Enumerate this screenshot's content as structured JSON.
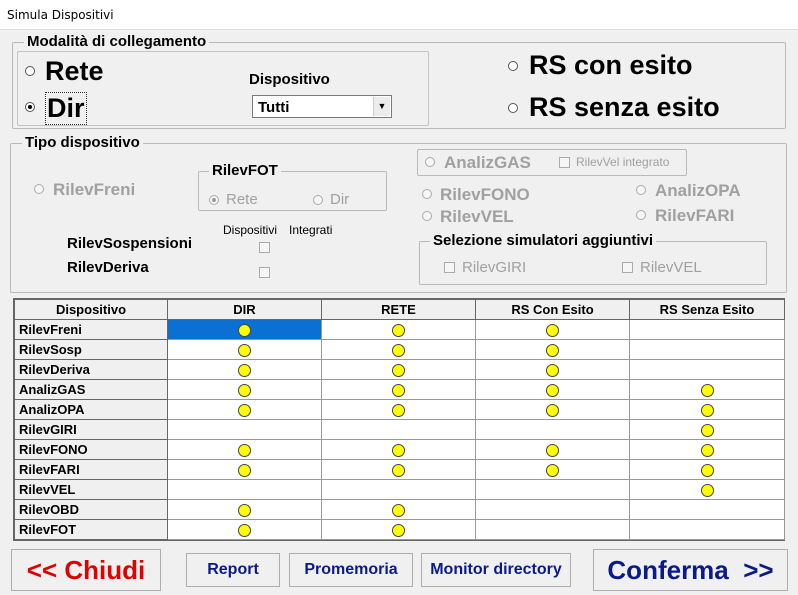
{
  "window": {
    "title": "Simula Dispositivi"
  },
  "collegamento": {
    "legend": "Modalità di collegamento",
    "rete_label": "Rete",
    "dir_label": "Dir",
    "selected": "Dir",
    "dispositivo_label": "Dispositivo",
    "dispositivo_value": "Tutti",
    "rs_con_label": "RS con esito",
    "rs_senza_label": "RS senza esito"
  },
  "tipo": {
    "legend": "Tipo dispositivo",
    "rilev_freni": "RilevFreni",
    "rilevfot_legend": "RilevFOT",
    "fot_rete": "Rete",
    "fot_dir": "Dir",
    "dispositivi_header": "Dispositivi",
    "integrati_header": "Integrati",
    "rilev_sospensioni": "RilevSospensioni",
    "rilev_deriva": "RilevDeriva",
    "analiz_gas": "AnalizGAS",
    "rilev_vel_integrato": "RilevVel integrato",
    "rilev_fono": "RilevFONO",
    "analiz_opa": "AnalizOPA",
    "rilev_vel": "RilevVEL",
    "rilev_fari": "RilevFARI",
    "sel_legend": "Selezione simulatori  aggiuntivi",
    "sel_giri": "RilevGIRI",
    "sel_vel": "RilevVEL"
  },
  "grid": {
    "columns": [
      "Dispositivo",
      "DIR",
      "RETE",
      "RS Con Esito",
      "RS Senza Esito"
    ],
    "rows": [
      {
        "name": "RilevFreni",
        "cells": [
          true,
          true,
          true,
          false
        ]
      },
      {
        "name": "RilevSosp",
        "cells": [
          true,
          true,
          true,
          false
        ]
      },
      {
        "name": "RilevDeriva",
        "cells": [
          true,
          true,
          true,
          false
        ]
      },
      {
        "name": "AnalizGAS",
        "cells": [
          true,
          true,
          true,
          true
        ]
      },
      {
        "name": "AnalizOPA",
        "cells": [
          true,
          true,
          true,
          true
        ]
      },
      {
        "name": "RilevGIRI",
        "cells": [
          false,
          false,
          false,
          true
        ]
      },
      {
        "name": "RilevFONO",
        "cells": [
          true,
          true,
          true,
          true
        ]
      },
      {
        "name": "RilevFARI",
        "cells": [
          true,
          true,
          true,
          true
        ]
      },
      {
        "name": "RilevVEL",
        "cells": [
          false,
          false,
          false,
          true
        ]
      },
      {
        "name": "RilevOBD",
        "cells": [
          true,
          true,
          false,
          false
        ]
      },
      {
        "name": "RilevFOT",
        "cells": [
          true,
          true,
          false,
          false
        ]
      }
    ],
    "selected_cell": {
      "row": 0,
      "col": 0
    },
    "selection_color": "#0a70d4",
    "dot_color": "#ffff00"
  },
  "buttons": {
    "chiudi": "<< Chiudi",
    "report": "Report",
    "promemoria": "Promemoria",
    "monitor": "Monitor directory",
    "conferma": "Conferma  >>"
  }
}
